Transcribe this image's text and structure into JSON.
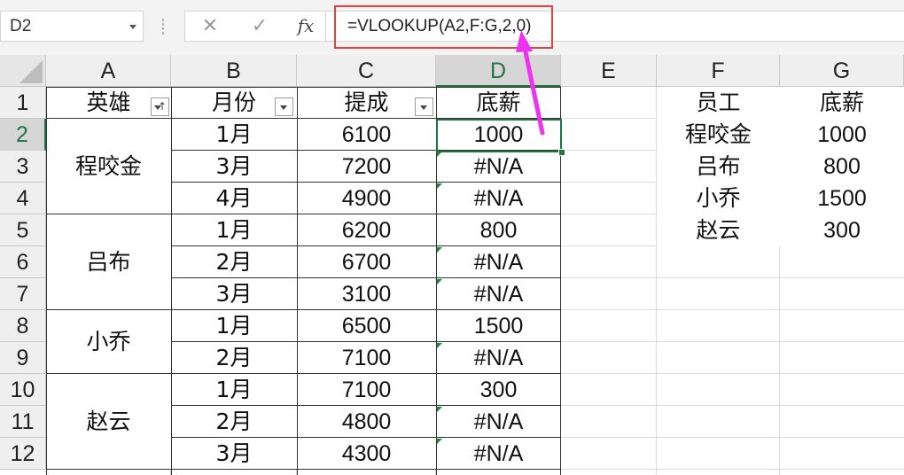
{
  "name_box": {
    "value": "D2"
  },
  "formula_bar": {
    "cancel_icon": "✕",
    "enter_icon": "✓",
    "fx_label": "fx",
    "formula": "=VLOOKUP(A2,F:G,2,0)"
  },
  "columns": [
    "A",
    "B",
    "C",
    "D",
    "E",
    "F",
    "G"
  ],
  "rows": [
    "1",
    "2",
    "3",
    "4",
    "5",
    "6",
    "7",
    "8",
    "9",
    "10",
    "11",
    "12"
  ],
  "selected_cell": "D2",
  "table_headers": {
    "hero": "英雄",
    "month": "月份",
    "commission": "提成",
    "base_salary": "底薪"
  },
  "heroes": [
    "程咬金",
    "吕布",
    "小乔",
    "赵云"
  ],
  "table_rows": [
    {
      "month": "1月",
      "commission": "6100",
      "base_salary": "1000"
    },
    {
      "month": "3月",
      "commission": "7200",
      "base_salary": "#N/A"
    },
    {
      "month": "4月",
      "commission": "4900",
      "base_salary": "#N/A"
    },
    {
      "month": "1月",
      "commission": "6200",
      "base_salary": "800"
    },
    {
      "month": "2月",
      "commission": "6700",
      "base_salary": "#N/A"
    },
    {
      "month": "3月",
      "commission": "3100",
      "base_salary": "#N/A"
    },
    {
      "month": "1月",
      "commission": "6500",
      "base_salary": "1500"
    },
    {
      "month": "2月",
      "commission": "7100",
      "base_salary": "#N/A"
    },
    {
      "month": "1月",
      "commission": "7100",
      "base_salary": "300"
    },
    {
      "month": "2月",
      "commission": "4800",
      "base_salary": "#N/A"
    },
    {
      "month": "3月",
      "commission": "4300",
      "base_salary": "#N/A"
    }
  ],
  "lookup_table": {
    "header_employee": "员工",
    "header_salary": "底薪",
    "rows": [
      {
        "employee": "程咬金",
        "salary": "1000"
      },
      {
        "employee": "吕布",
        "salary": "800"
      },
      {
        "employee": "小乔",
        "salary": "1500"
      },
      {
        "employee": "赵云",
        "salary": "300"
      }
    ]
  },
  "colors": {
    "selection": "#217346",
    "formula_highlight": "#e34040",
    "annotation_arrow": "#ee33ee",
    "error_flag": "#1e8a3c"
  }
}
